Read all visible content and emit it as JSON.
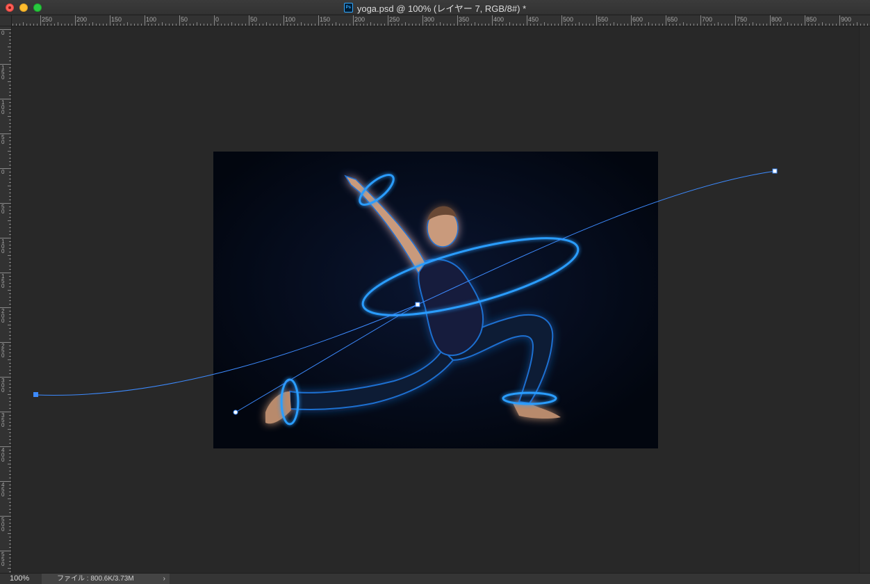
{
  "window": {
    "title": "yoga.psd @ 100% (レイヤー 7, RGB/8#) *",
    "app_icon": "photoshop-icon",
    "app_icon_text": "Ps"
  },
  "ruler_h": {
    "labels": [
      "250",
      "200",
      "150",
      "100",
      "50",
      "0",
      "50",
      "100",
      "150",
      "200",
      "250",
      "300",
      "350",
      "400",
      "450",
      "500",
      "550",
      "600",
      "650",
      "700",
      "750",
      "800",
      "850",
      "900"
    ]
  },
  "ruler_v": {
    "labels": [
      "0",
      "150",
      "100",
      "50",
      "0",
      "50",
      "100",
      "150",
      "200",
      "250",
      "300",
      "350",
      "400",
      "450",
      "500",
      "550"
    ]
  },
  "status": {
    "zoom": "100%",
    "file_info": "ファイル : 800.6K/3.73M",
    "chevron": "›"
  },
  "path_tool": {
    "color": "#3d8bff"
  },
  "colors": {
    "canvas_bg": "#030818",
    "glow": "#1e90ff",
    "workspace": "#282828"
  }
}
